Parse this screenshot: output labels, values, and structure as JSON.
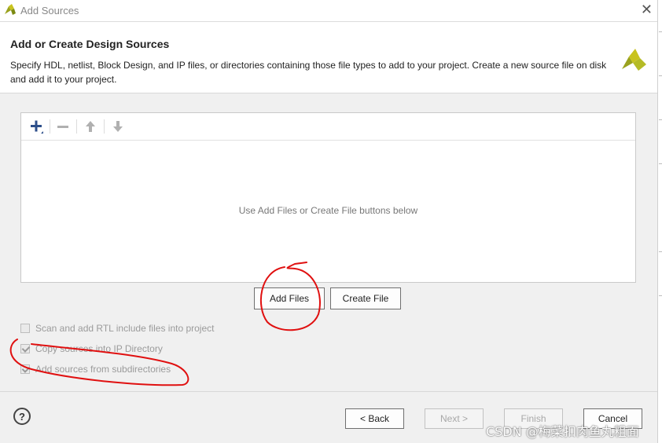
{
  "window": {
    "title": "Add Sources",
    "close_icon": "close-icon"
  },
  "header": {
    "title": "Add or Create Design Sources",
    "description": "Specify HDL, netlist, Block Design, and IP files, or directories containing those file types to add to your project. Create a new source file on disk and add it to your project."
  },
  "toolbar": {
    "icons": [
      "add-icon",
      "remove-icon",
      "move-up-icon",
      "move-down-icon"
    ]
  },
  "file_list": {
    "empty_message": "Use Add Files or Create File buttons below"
  },
  "actions": {
    "add_files": "Add Files",
    "create_file": "Create File"
  },
  "options": [
    {
      "label": "Scan and add RTL include files into project",
      "checked": false,
      "enabled": false
    },
    {
      "label": "Copy sources into IP Directory",
      "checked": true,
      "enabled": false
    },
    {
      "label": "Add sources from subdirectories",
      "checked": true,
      "enabled": false
    }
  ],
  "footer": {
    "help": "?",
    "back": "< Back",
    "next": "Next >",
    "finish": "Finish",
    "cancel": "Cancel"
  },
  "watermark": "CSDN @梅菜扣肉鱼丸粗面",
  "colors": {
    "logo_yellow": "#c8c31e",
    "logo_green": "#9aa21e",
    "annotation_red": "#e01010"
  }
}
